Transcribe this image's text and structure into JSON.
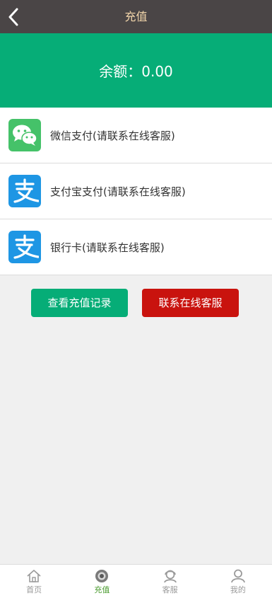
{
  "header": {
    "title": "充值",
    "back_icon": "chevron-left-icon"
  },
  "balance": {
    "text": "余额：0.00"
  },
  "payment_methods": [
    {
      "label": "微信支付(请联系在线客服)",
      "icon": "wechat-icon",
      "color": "#45c269"
    },
    {
      "label": "支付宝支付(请联系在线客服)",
      "icon": "alipay-icon",
      "color": "#1e96e4"
    },
    {
      "label": "银行卡(请联系在线客服)",
      "icon": "alipay-icon",
      "color": "#1e96e4"
    }
  ],
  "actions": {
    "records_label": "查看充值记录",
    "service_label": "联系在线客服"
  },
  "bottom_nav": [
    {
      "label": "首页",
      "icon": "home-icon",
      "active": false
    },
    {
      "label": "充值",
      "icon": "recharge-icon",
      "active": true
    },
    {
      "label": "客服",
      "icon": "customer-service-icon",
      "active": false
    },
    {
      "label": "我的",
      "icon": "user-icon",
      "active": false
    }
  ],
  "colors": {
    "header_bg": "#4a4546",
    "header_title": "#f3d6ab",
    "banner_bg": "#06ad77",
    "primary_button": "#06ad77",
    "danger_button": "#c9130e",
    "nav_active": "#4a9b2e",
    "nav_inactive": "#9a9a9a"
  }
}
